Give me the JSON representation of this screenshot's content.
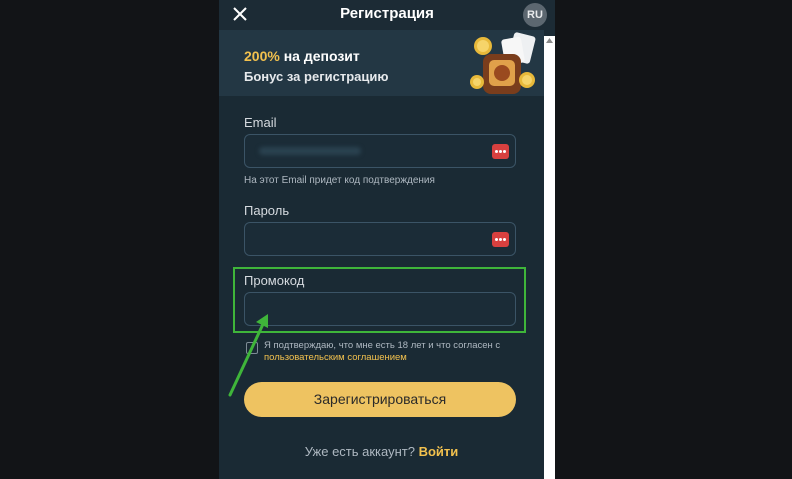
{
  "header": {
    "title": "Регистрация",
    "lang": "RU",
    "close_icon": "close-icon"
  },
  "banner": {
    "bonus_percent": "200%",
    "bonus_rest": " на депозит",
    "subtitle": "Бонус за регистрацию",
    "art_icon": "slot-coins-illustration"
  },
  "form": {
    "email_label": "Email",
    "email_hint": "На этот Email придет код подтверждения",
    "password_label": "Пароль",
    "promo_label": "Промокод",
    "consent_text": "Я подтверждаю, что мне есть 18 лет и что согласен с ",
    "consent_link": "пользовательским соглашением",
    "register_label": "Зарегистрироваться",
    "password_manager_icon": "password-manager-icon"
  },
  "footer": {
    "question": "Уже есть аккаунт? ",
    "login_label": "Войти"
  },
  "colors": {
    "accent": "#f2c14e",
    "button": "#eec361",
    "panel": "#1a2a34",
    "highlight": "#3fb53a"
  }
}
